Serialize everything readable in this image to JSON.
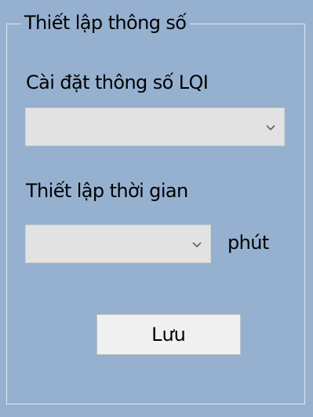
{
  "groupbox": {
    "title": "Thiết lập thông số"
  },
  "lqi": {
    "label": "Cài đặt thông số LQI",
    "selected_value": ""
  },
  "time": {
    "label": "Thiết lập thời gian",
    "selected_value": "",
    "unit": "phút"
  },
  "actions": {
    "save_label": "Lưu"
  },
  "icons": {
    "dropdown": "chevron-down-icon"
  },
  "colors": {
    "panel_background": "#96b1d0",
    "group_border": "#dce6f2",
    "combo_background": "#e2e2e2",
    "button_background": "#f0f0f0"
  }
}
